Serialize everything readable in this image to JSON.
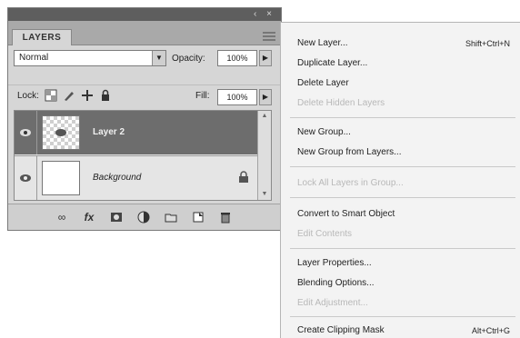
{
  "panel": {
    "tab_label": "LAYERS",
    "blend_mode": "Normal",
    "opacity_label": "Opacity:",
    "opacity_value": "100%",
    "lock_label": "Lock:",
    "fill_label": "Fill:",
    "fill_value": "100%",
    "layers": [
      {
        "name": "Layer 2",
        "selected": true
      },
      {
        "name": "Background",
        "selected": false,
        "locked": true
      }
    ],
    "icons": {
      "link": "link-icon",
      "fx": "fx-icon",
      "mask": "add-mask-icon",
      "adjustment": "adjustment-layer-icon",
      "group": "new-group-icon",
      "new_layer": "new-layer-icon",
      "delete": "trash-icon"
    }
  },
  "menu": {
    "items": [
      {
        "label": "New Layer...",
        "shortcut": "Shift+Ctrl+N",
        "disabled": false
      },
      {
        "label": "Duplicate Layer...",
        "shortcut": "",
        "disabled": false
      },
      {
        "label": "Delete Layer",
        "shortcut": "",
        "disabled": false
      },
      {
        "label": "Delete Hidden Layers",
        "shortcut": "",
        "disabled": true
      },
      {
        "label": "New Group...",
        "shortcut": "",
        "disabled": false
      },
      {
        "label": "New Group from Layers...",
        "shortcut": "",
        "disabled": false
      },
      {
        "label": "Lock All Layers in Group...",
        "shortcut": "",
        "disabled": true
      },
      {
        "label": "Convert to Smart Object",
        "shortcut": "",
        "disabled": false
      },
      {
        "label": "Edit Contents",
        "shortcut": "",
        "disabled": true
      },
      {
        "label": "Layer Properties...",
        "shortcut": "",
        "disabled": false
      },
      {
        "label": "Blending Options...",
        "shortcut": "",
        "disabled": false
      },
      {
        "label": "Edit Adjustment...",
        "shortcut": "",
        "disabled": true
      },
      {
        "label": "Create Clipping Mask",
        "shortcut": "Alt+Ctrl+G",
        "disabled": false
      }
    ]
  }
}
